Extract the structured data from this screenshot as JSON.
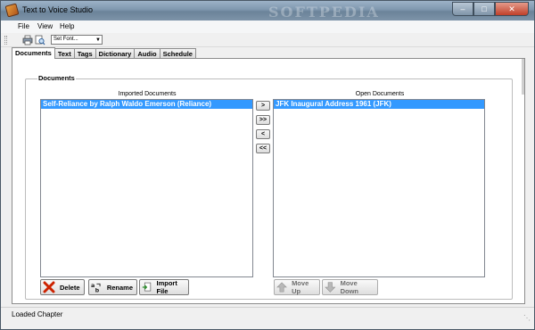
{
  "window": {
    "title": "Text to Voice Studio",
    "watermark": "SOFTPEDIA"
  },
  "menu": [
    "File",
    "View",
    "Help"
  ],
  "toolbar": {
    "font_select_value": "Set Font..."
  },
  "tabs": [
    {
      "label": "Documents",
      "active": true
    },
    {
      "label": "Text",
      "active": false
    },
    {
      "label": "Tags",
      "active": false
    },
    {
      "label": "Dictionary",
      "active": false
    },
    {
      "label": "Audio",
      "active": false
    },
    {
      "label": "Schedule",
      "active": false
    }
  ],
  "documents": {
    "group_label": "Documents",
    "imported": {
      "caption": "Imported Documents",
      "items": [
        "Self-Reliance by Ralph Waldo Emerson (Reliance)"
      ]
    },
    "open": {
      "caption": "Open Documents",
      "items": [
        "JFK Inaugural Address 1961 (JFK)"
      ]
    },
    "transfer_buttons": [
      ">",
      ">>",
      "<",
      "<<"
    ],
    "buttons": {
      "delete": "Delete",
      "rename": "Rename",
      "import": "Import File",
      "move_up": "Move Up",
      "move_down": "Move Down"
    }
  },
  "status": {
    "text": "Loaded Chapter"
  },
  "colors": {
    "selection": "#3399ff",
    "delete_icon": "#cc2200",
    "import_icon": "#2f8f2f",
    "move_icon_disabled": "#9a9a9a"
  }
}
